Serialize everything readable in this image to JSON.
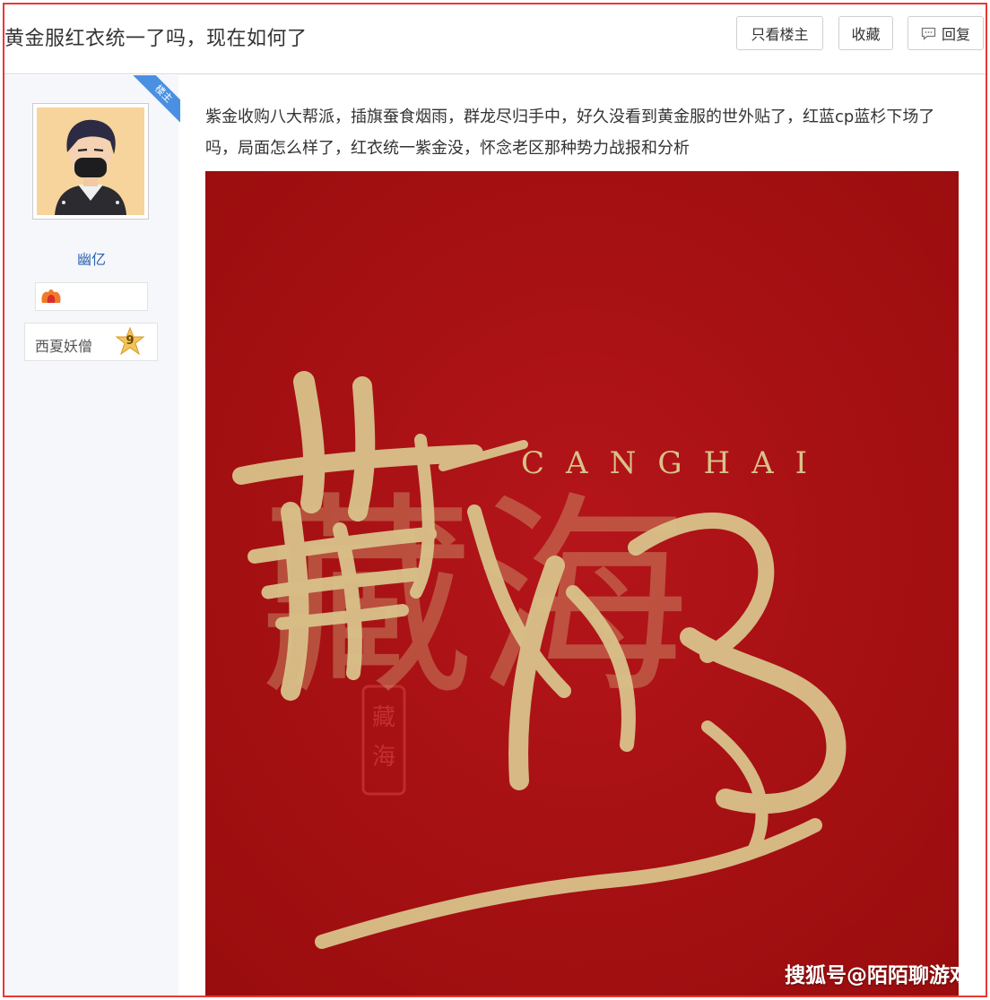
{
  "thread": {
    "title": "黄金服红衣统一了吗，现在如何了"
  },
  "toolbar": {
    "only_op_label": "只看楼主",
    "favorite_label": "收藏",
    "reply_label": "回复",
    "reply_icon": "comment-icon"
  },
  "author": {
    "badge": "楼主",
    "name": "幽亿",
    "medal_icon": "medal-icon",
    "level_title": "西夏妖僧",
    "level": "9"
  },
  "post": {
    "text": "紫金收购八大帮派，插旗蚕食烟雨，群龙尽归手中，好久没看到黄金服的世外贴了，红蓝cp蓝杉下场了吗，局面怎么样了，红衣统一紫金没，怀念老区那种势力战报和分析",
    "image": {
      "caption_latin": "CANGHAI",
      "calligraphy": "藏海",
      "seal": "藏海",
      "watermark": "搜狐号@陌陌聊游戏"
    }
  },
  "colors": {
    "frame_border": "#e53935",
    "link_blue": "#2d64b3",
    "badge_blue": "#4a90e2",
    "image_red": "#a8100f",
    "gold": "#d9c28a"
  }
}
